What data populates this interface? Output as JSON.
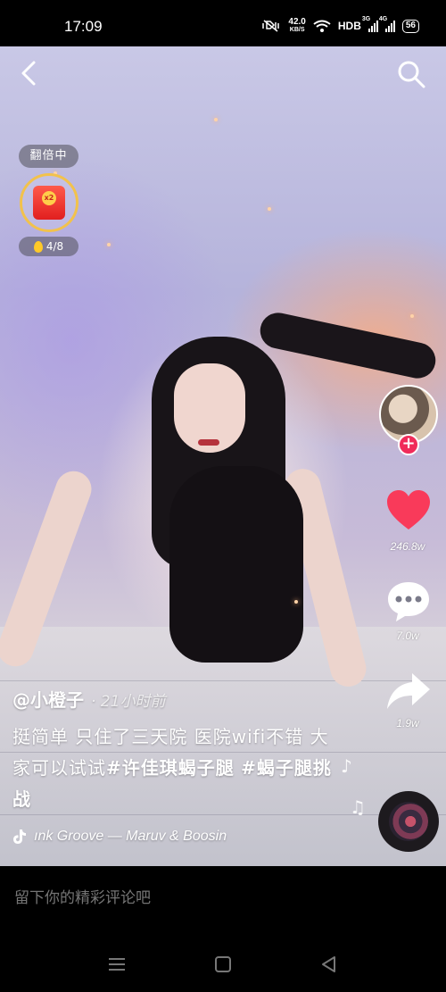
{
  "status_bar": {
    "time": "17:09",
    "net_speed_value": "42.0",
    "net_speed_unit": "KB/S",
    "hd_label": "HDB",
    "sim1_label": "3G",
    "sim2_label": "4G",
    "battery": "56"
  },
  "top_overlay": {
    "back_icon": "chevron-left-icon",
    "search_icon": "search-icon"
  },
  "red_packet": {
    "badge_label": "翻倍中",
    "coin_label": "x2",
    "progress_label": "4/8"
  },
  "right_rail": {
    "likes": "246.8w",
    "comments": "7.0w",
    "shares": "1.9w",
    "colors": {
      "like": "#f93a5a",
      "follow": "#f02c5a"
    }
  },
  "post": {
    "author": "@小橙子",
    "time_ago": "· 21小时前",
    "caption_text": "挺简单 只住了三天院 医院wifi不错 大家可以试试",
    "hashtags": [
      "#许佳琪蝎子腿",
      "#蝎子腿挑战"
    ],
    "music": "ınk Groove — Maruv & Boosin"
  },
  "comment_bar": {
    "placeholder": "留下你的精彩评论吧"
  },
  "nav_bar": {
    "icons": [
      "menu-icon",
      "home-square-icon",
      "back-triangle-icon"
    ]
  }
}
